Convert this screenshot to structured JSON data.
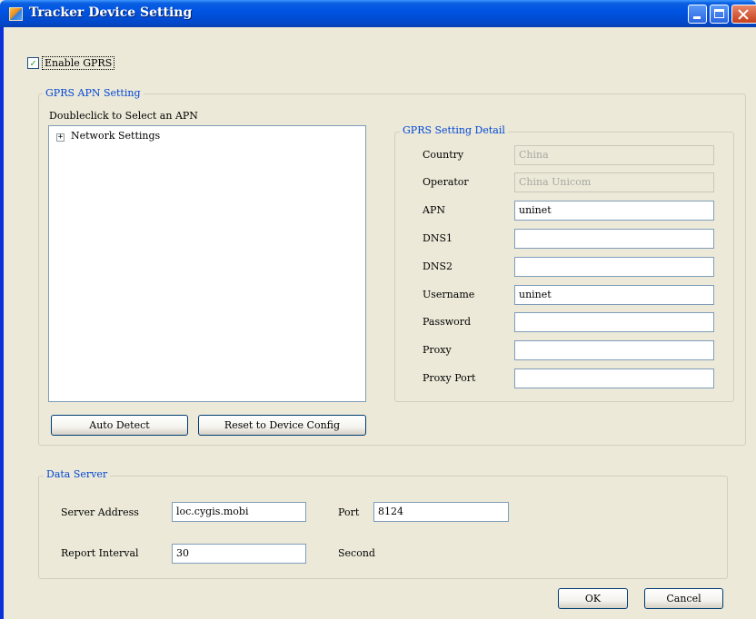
{
  "window": {
    "title": "Tracker Device Setting"
  },
  "enable_gprs": {
    "label": "Enable GPRS",
    "checked": true
  },
  "apn_group": {
    "title": "GPRS APN Setting",
    "instruction": "Doubleclick to Select an APN",
    "tree": [
      {
        "label": "Network Settings",
        "expanded": false
      }
    ],
    "auto_detect_label": "Auto Detect",
    "reset_label": "Reset to Device Config"
  },
  "detail_group": {
    "title": "GPRS Setting Detail",
    "fields": [
      {
        "label": "Country",
        "value": "China",
        "enabled": false
      },
      {
        "label": "Operator",
        "value": "China Unicom",
        "enabled": false
      },
      {
        "label": "APN",
        "value": "uninet",
        "enabled": true
      },
      {
        "label": "DNS1",
        "value": "",
        "enabled": true
      },
      {
        "label": "DNS2",
        "value": "",
        "enabled": true
      },
      {
        "label": "Username",
        "value": "uninet",
        "enabled": true
      },
      {
        "label": "Password",
        "value": "",
        "enabled": true
      },
      {
        "label": "Proxy",
        "value": "",
        "enabled": true
      },
      {
        "label": "Proxy Port",
        "value": "",
        "enabled": true
      }
    ]
  },
  "server_group": {
    "title": "Data Server",
    "server_address_label": "Server Address",
    "server_address_value": "loc.cygis.mobi",
    "port_label": "Port",
    "port_value": "8124",
    "report_interval_label": "Report Interval",
    "report_interval_value": "30",
    "unit_label": "Second"
  },
  "footer": {
    "ok_label": "OK",
    "cancel_label": "Cancel"
  },
  "colors": {
    "title_bar": "#0054e3",
    "window_bg": "#ece9d8",
    "group_title": "#0046d5",
    "checkmark": "#21a121"
  }
}
